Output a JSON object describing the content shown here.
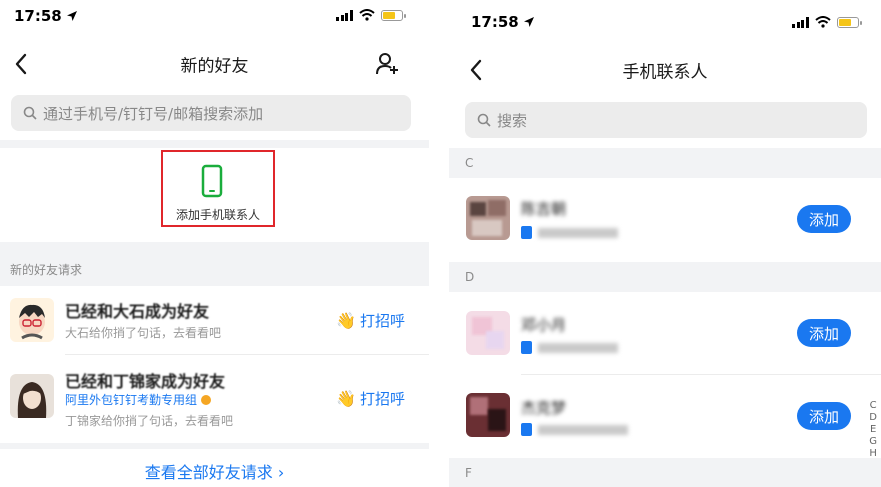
{
  "left": {
    "status": {
      "time": "17:58"
    },
    "title": "新的好友",
    "search_placeholder": "通过手机号/钉钉号/邮箱搜索添加",
    "add_phone_contacts_label": "添加手机联系人",
    "section_label": "新的好友请求",
    "requests": [
      {
        "name": "已经和大石成为好友",
        "subtitle": "大石给你捎了句话，去看看吧",
        "action": "打招呼"
      },
      {
        "name": "已经和丁锦家成为好友",
        "org": "阿里外包钉钉考勤专用组",
        "subtitle": "丁锦家给你捎了句话，去看看吧",
        "action": "打招呼"
      }
    ],
    "view_all": "查看全部好友请求 ›"
  },
  "right": {
    "status": {
      "time": "17:58"
    },
    "title": "手机联系人",
    "search_placeholder": "搜索",
    "sections": [
      {
        "letter": "C",
        "contacts": [
          {
            "name": "陈吉朝",
            "button": "添加"
          }
        ]
      },
      {
        "letter": "D",
        "contacts": [
          {
            "name": "邓小月",
            "button": "添加"
          },
          {
            "name": "杰克梦",
            "button": "添加"
          }
        ]
      },
      {
        "letter": "F"
      }
    ],
    "alphabet_index": [
      "C",
      "D",
      "E",
      "G",
      "H"
    ]
  },
  "colors": {
    "accent": "#1a78f0",
    "highlight_box": "#e0262b",
    "phone_icon": "#1aad3c",
    "band": "#f2f3f5"
  }
}
